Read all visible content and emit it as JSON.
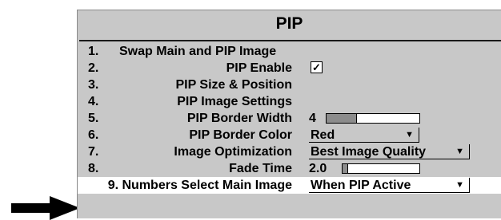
{
  "menu": {
    "title": "PIP",
    "items": [
      {
        "num": "1.",
        "label": "Swap Main and PIP Image"
      },
      {
        "num": "2.",
        "label": "PIP Enable",
        "checked": true,
        "check_glyph": "✓"
      },
      {
        "num": "3.",
        "label": "PIP Size & Position"
      },
      {
        "num": "4.",
        "label": "PIP Image Settings"
      },
      {
        "num": "5.",
        "label": "PIP Border Width",
        "value": "4",
        "slider_fraction": 0.33
      },
      {
        "num": "6.",
        "label": "PIP Border Color",
        "value": "Red"
      },
      {
        "num": "7.",
        "label": "Image Optimization",
        "value": "Best Image Quality"
      },
      {
        "num": "8.",
        "label": "Fade Time",
        "value": "2.0",
        "slider_fraction": 0.07
      },
      {
        "num": "9.",
        "label": "Numbers Select Main Image",
        "value": "When PIP Active"
      }
    ]
  },
  "pointer": {
    "icon": "right-arrow-icon",
    "target_item": 9
  }
}
